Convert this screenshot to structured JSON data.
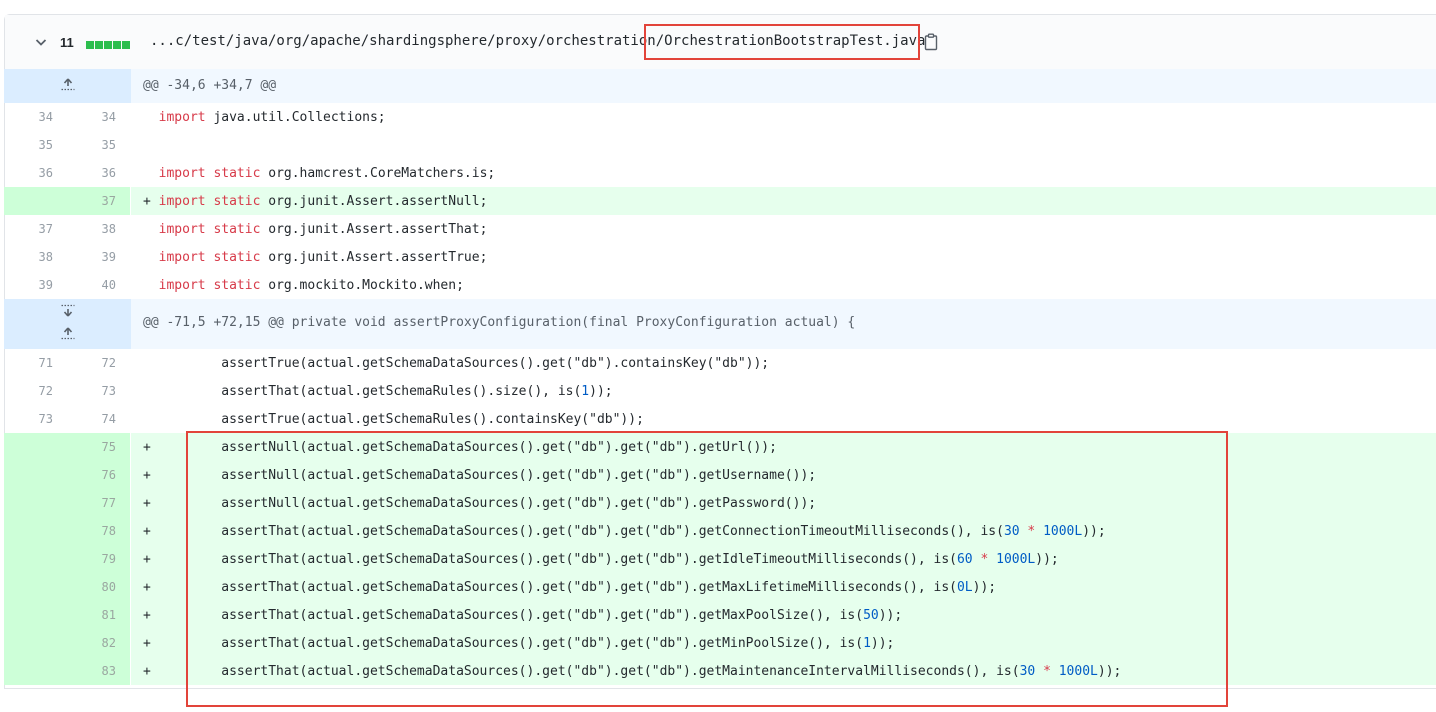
{
  "file_header": {
    "changed_count": "11",
    "path": "...c/test/java/org/apache/shardingsphere/proxy/orchestration/OrchestrationBootstrapTest.java",
    "icons": [
      "chevron-down-icon",
      "clipboard-icon"
    ],
    "diffstat_blocks": 5,
    "diffstat_color": "#2cbe4e"
  },
  "hunks": [
    {
      "header": "@@ -34,6 +34,7 @@"
    },
    {
      "header": "@@ -71,5 +72,15 @@ private void assertProxyConfiguration(final ProxyConfiguration actual) {"
    }
  ],
  "lines_block1": [
    {
      "old": "34",
      "new": "34",
      "sign": " ",
      "pre": "import",
      "kw2": "",
      "rest": " java.util.Collections;"
    },
    {
      "old": "35",
      "new": "35",
      "sign": " ",
      "pre": "",
      "kw2": "",
      "rest": ""
    },
    {
      "old": "36",
      "new": "36",
      "sign": " ",
      "pre": "import",
      "kw2": " static",
      "rest": " org.hamcrest.CoreMatchers.is;"
    },
    {
      "old": "",
      "new": "37",
      "sign": "+",
      "pre": "import",
      "kw2": " static",
      "rest": " org.junit.Assert.assertNull;"
    },
    {
      "old": "37",
      "new": "38",
      "sign": " ",
      "pre": "import",
      "kw2": " static",
      "rest": " org.junit.Assert.assertThat;"
    },
    {
      "old": "38",
      "new": "39",
      "sign": " ",
      "pre": "import",
      "kw2": " static",
      "rest": " org.junit.Assert.assertTrue;"
    },
    {
      "old": "39",
      "new": "40",
      "sign": " ",
      "pre": "import",
      "kw2": " static",
      "rest": " org.mockito.Mockito.when;"
    }
  ],
  "lines_block2": [
    {
      "old": "71",
      "new": "72",
      "sign": " ",
      "text": "        assertTrue(actual.getSchemaDataSources().get(\"db\").containsKey(\"db\"));"
    },
    {
      "old": "72",
      "new": "73",
      "sign": " ",
      "text": "        assertThat(actual.getSchemaRules().size(), is(",
      "num": "1",
      "tail": "));"
    },
    {
      "old": "73",
      "new": "74",
      "sign": " ",
      "text": "        assertTrue(actual.getSchemaRules().containsKey(\"db\"));"
    },
    {
      "old": "",
      "new": "75",
      "sign": "+",
      "text": "        assertNull(actual.getSchemaDataSources().get(\"db\").get(\"db\").getUrl());"
    },
    {
      "old": "",
      "new": "76",
      "sign": "+",
      "text": "        assertNull(actual.getSchemaDataSources().get(\"db\").get(\"db\").getUsername());"
    },
    {
      "old": "",
      "new": "77",
      "sign": "+",
      "text": "        assertNull(actual.getSchemaDataSources().get(\"db\").get(\"db\").getPassword());"
    },
    {
      "old": "",
      "new": "78",
      "sign": "+",
      "text": "        assertThat(actual.getSchemaDataSources().get(\"db\").get(\"db\").getConnectionTimeoutMilliseconds(), is(",
      "num": "30",
      "op": " * ",
      "num2": "1000L",
      "tail": "));"
    },
    {
      "old": "",
      "new": "79",
      "sign": "+",
      "text": "        assertThat(actual.getSchemaDataSources().get(\"db\").get(\"db\").getIdleTimeoutMilliseconds(), is(",
      "num": "60",
      "op": " * ",
      "num2": "1000L",
      "tail": "));"
    },
    {
      "old": "",
      "new": "80",
      "sign": "+",
      "text": "        assertThat(actual.getSchemaDataSources().get(\"db\").get(\"db\").getMaxLifetimeMilliseconds(), is(",
      "num": "0L",
      "tail": "));"
    },
    {
      "old": "",
      "new": "81",
      "sign": "+",
      "text": "        assertThat(actual.getSchemaDataSources().get(\"db\").get(\"db\").getMaxPoolSize(), is(",
      "num": "50",
      "tail": "));"
    },
    {
      "old": "",
      "new": "82",
      "sign": "+",
      "text": "        assertThat(actual.getSchemaDataSources().get(\"db\").get(\"db\").getMinPoolSize(), is(",
      "num": "1",
      "tail": "));"
    },
    {
      "old": "",
      "new": "83",
      "sign": "+",
      "text": "        assertThat(actual.getSchemaDataSources().get(\"db\").get(\"db\").getMaintenanceIntervalMilliseconds(), is(",
      "num": "30",
      "op": " * ",
      "num2": "1000L",
      "tail": "));"
    }
  ]
}
